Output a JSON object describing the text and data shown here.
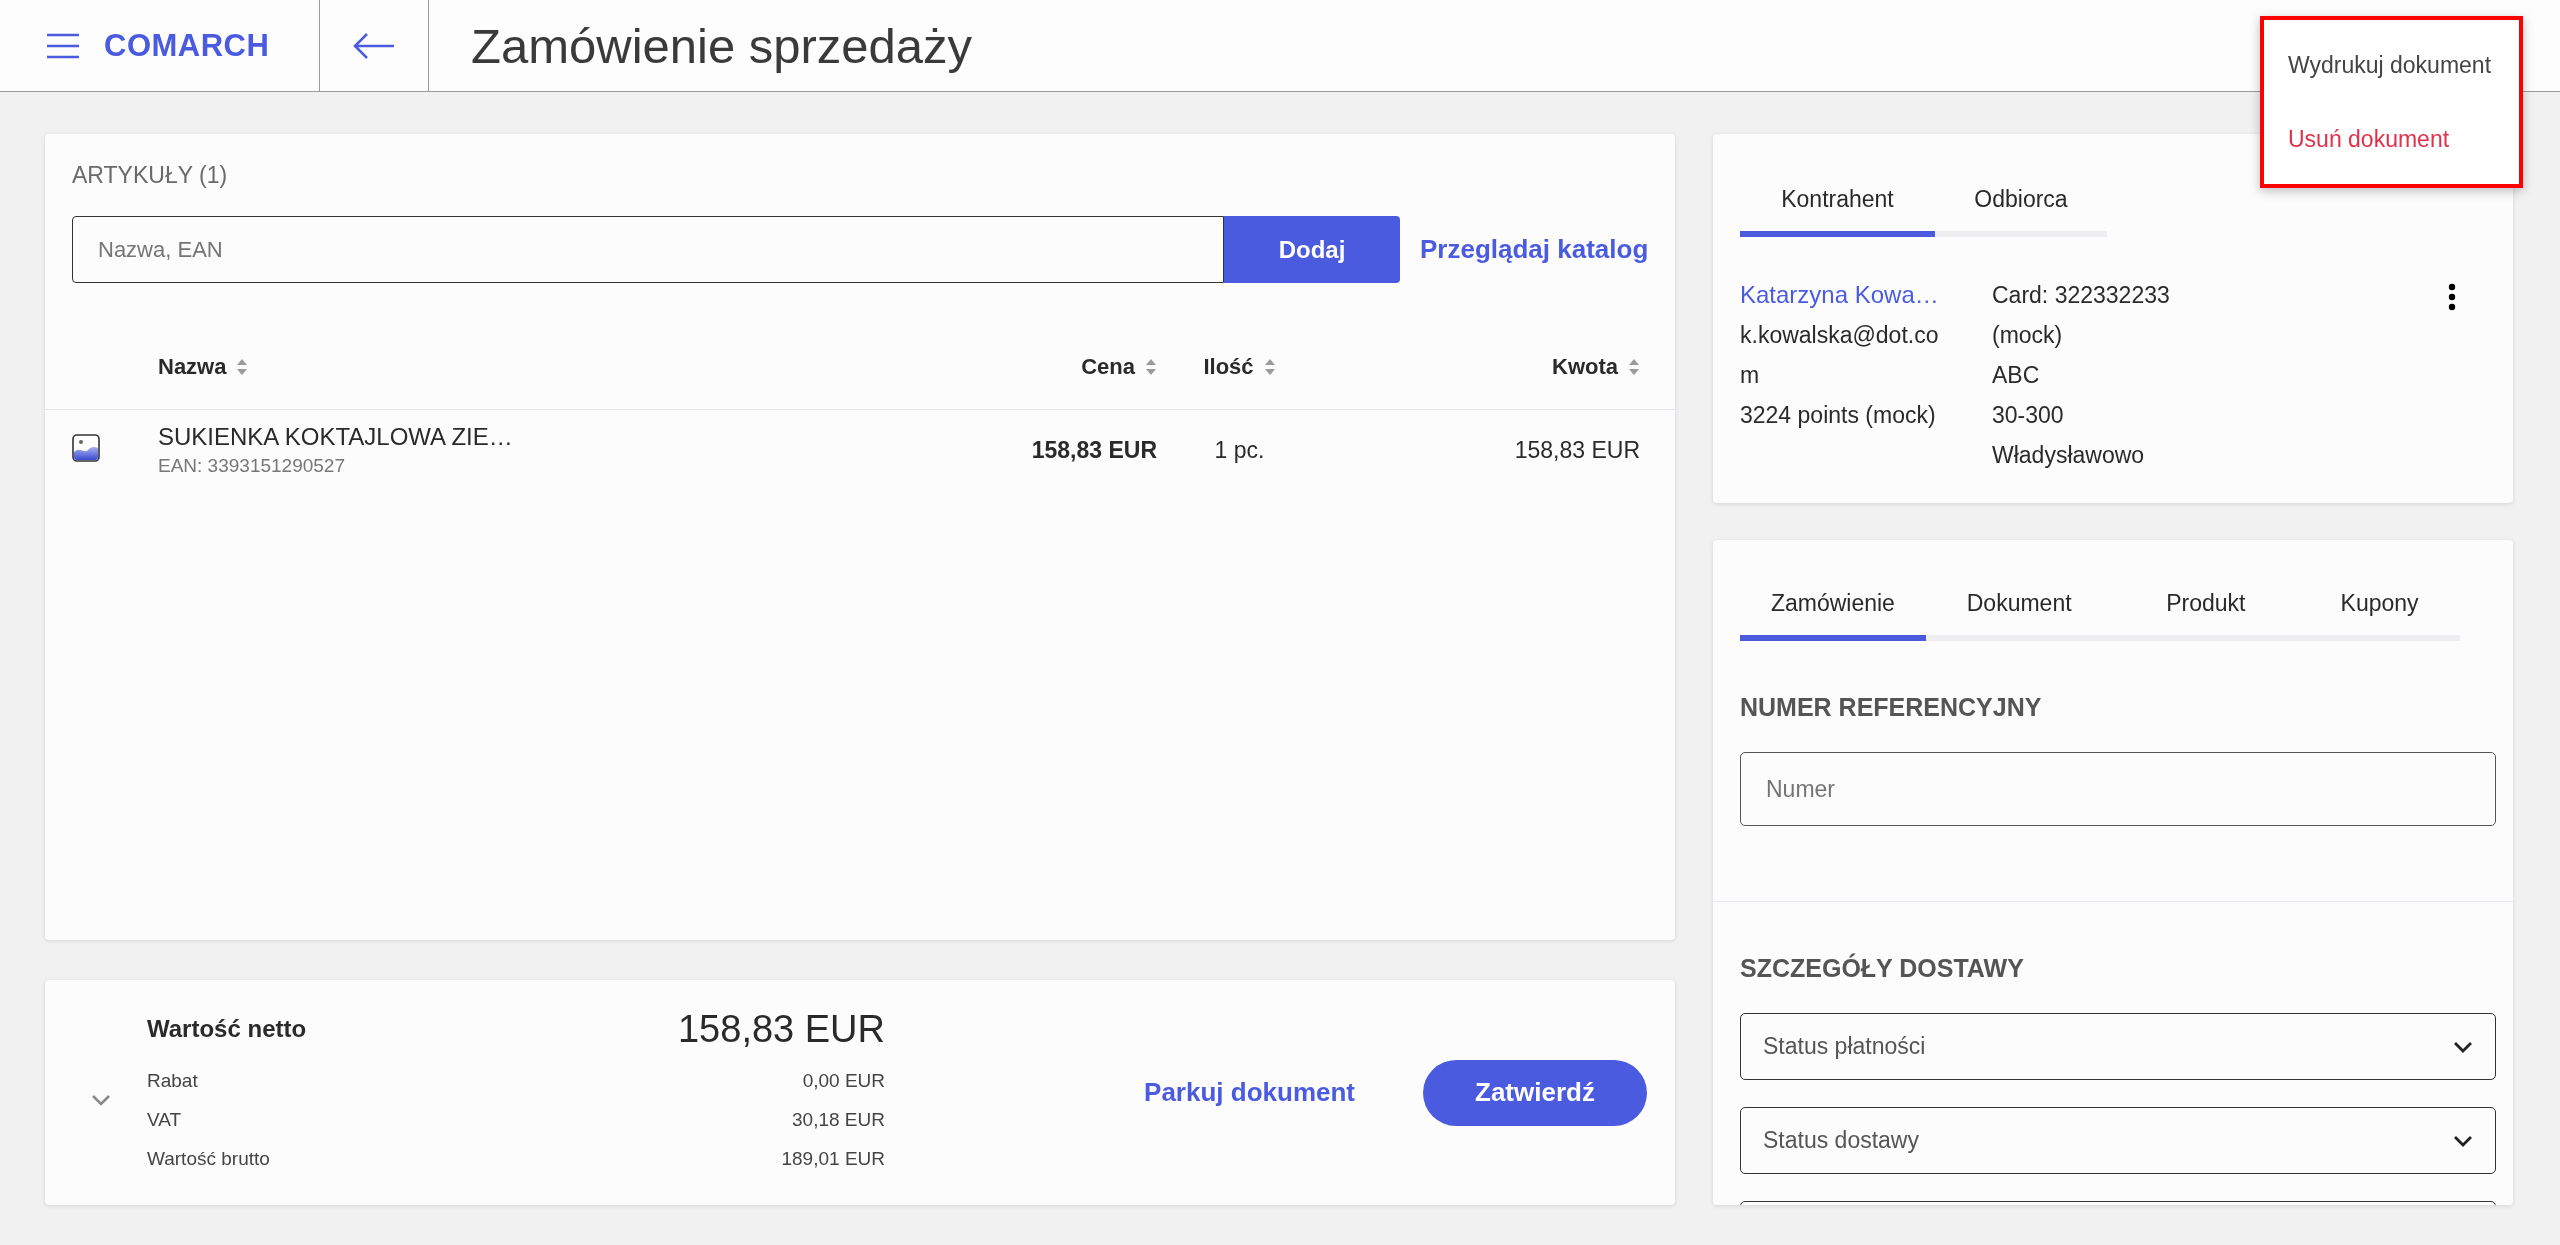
{
  "header": {
    "logo": "COMARCH",
    "title": "Zamówienie sprzedaży"
  },
  "context_menu": {
    "items": [
      {
        "label": "Wydrukuj dokument",
        "kind": "normal"
      },
      {
        "label": "Usuń dokument",
        "kind": "danger"
      }
    ]
  },
  "articles": {
    "heading": "ARTYKUŁY (1)",
    "search": {
      "placeholder": "Nazwa, EAN"
    },
    "add_button": "Dodaj",
    "catalog_link": "Przeglądaj katalog",
    "columns": [
      {
        "label": "Nazwa"
      },
      {
        "label": "Cena"
      },
      {
        "label": "Ilość"
      },
      {
        "label": "Kwota"
      }
    ],
    "rows": [
      {
        "name": "SUKIENKA KOKTAJLOWA ZIE…",
        "ean": "EAN: 3393151290527",
        "price": "158,83 EUR",
        "quantity": "1 pc.",
        "amount": "158,83 EUR"
      }
    ]
  },
  "totals": {
    "net_label": "Wartość netto",
    "net_value": "158,83 EUR",
    "lines": [
      {
        "label": "Rabat",
        "value": "0,00 EUR"
      },
      {
        "label": "VAT",
        "value": "30,18 EUR"
      },
      {
        "label": "Wartość brutto",
        "value": "189,01 EUR"
      }
    ],
    "park_link": "Parkuj dokument",
    "confirm_button": "Zatwierdź"
  },
  "customer": {
    "tabs": [
      {
        "label": "Kontrahent",
        "selected": true
      },
      {
        "label": "Odbiorca",
        "selected": false
      }
    ],
    "name": "Katarzyna Kowa…",
    "email": "k.kowalska@dot.com",
    "points": "3224 points (mock)",
    "card": "Card: 322332233 (mock)",
    "company": "ABC",
    "address": "30-300 Władysławowo"
  },
  "order": {
    "tabs": [
      {
        "label": "Zamówienie",
        "selected": true
      },
      {
        "label": "Dokument",
        "selected": false
      },
      {
        "label": "Produkt",
        "selected": false
      },
      {
        "label": "Kupony",
        "selected": false
      }
    ],
    "reference_heading": "NUMER REFERENCYJNY",
    "reference_field": {
      "placeholder": "Numer"
    },
    "delivery_heading": "SZCZEGÓŁY DOSTAWY",
    "selects": [
      {
        "placeholder": "Status płatności"
      },
      {
        "placeholder": "Status dostawy"
      }
    ]
  }
}
